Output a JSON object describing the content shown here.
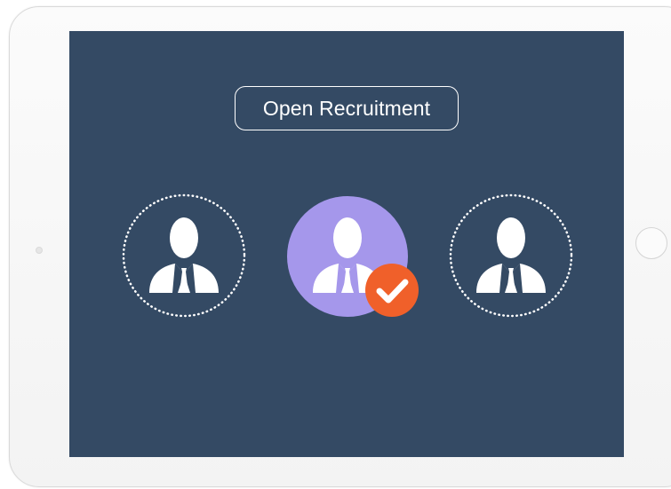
{
  "screen": {
    "title": "Open Recruitment",
    "background_color": "#344a64"
  },
  "candidates": [
    {
      "name": "candidate-left",
      "state": "unselected",
      "icon": "person-icon"
    },
    {
      "name": "candidate-center",
      "state": "selected",
      "icon": "person-icon",
      "highlight_color": "#a597eb"
    },
    {
      "name": "candidate-right",
      "state": "unselected",
      "icon": "person-icon"
    }
  ],
  "badge": {
    "icon": "checkmark-icon",
    "color": "#f0602a"
  }
}
